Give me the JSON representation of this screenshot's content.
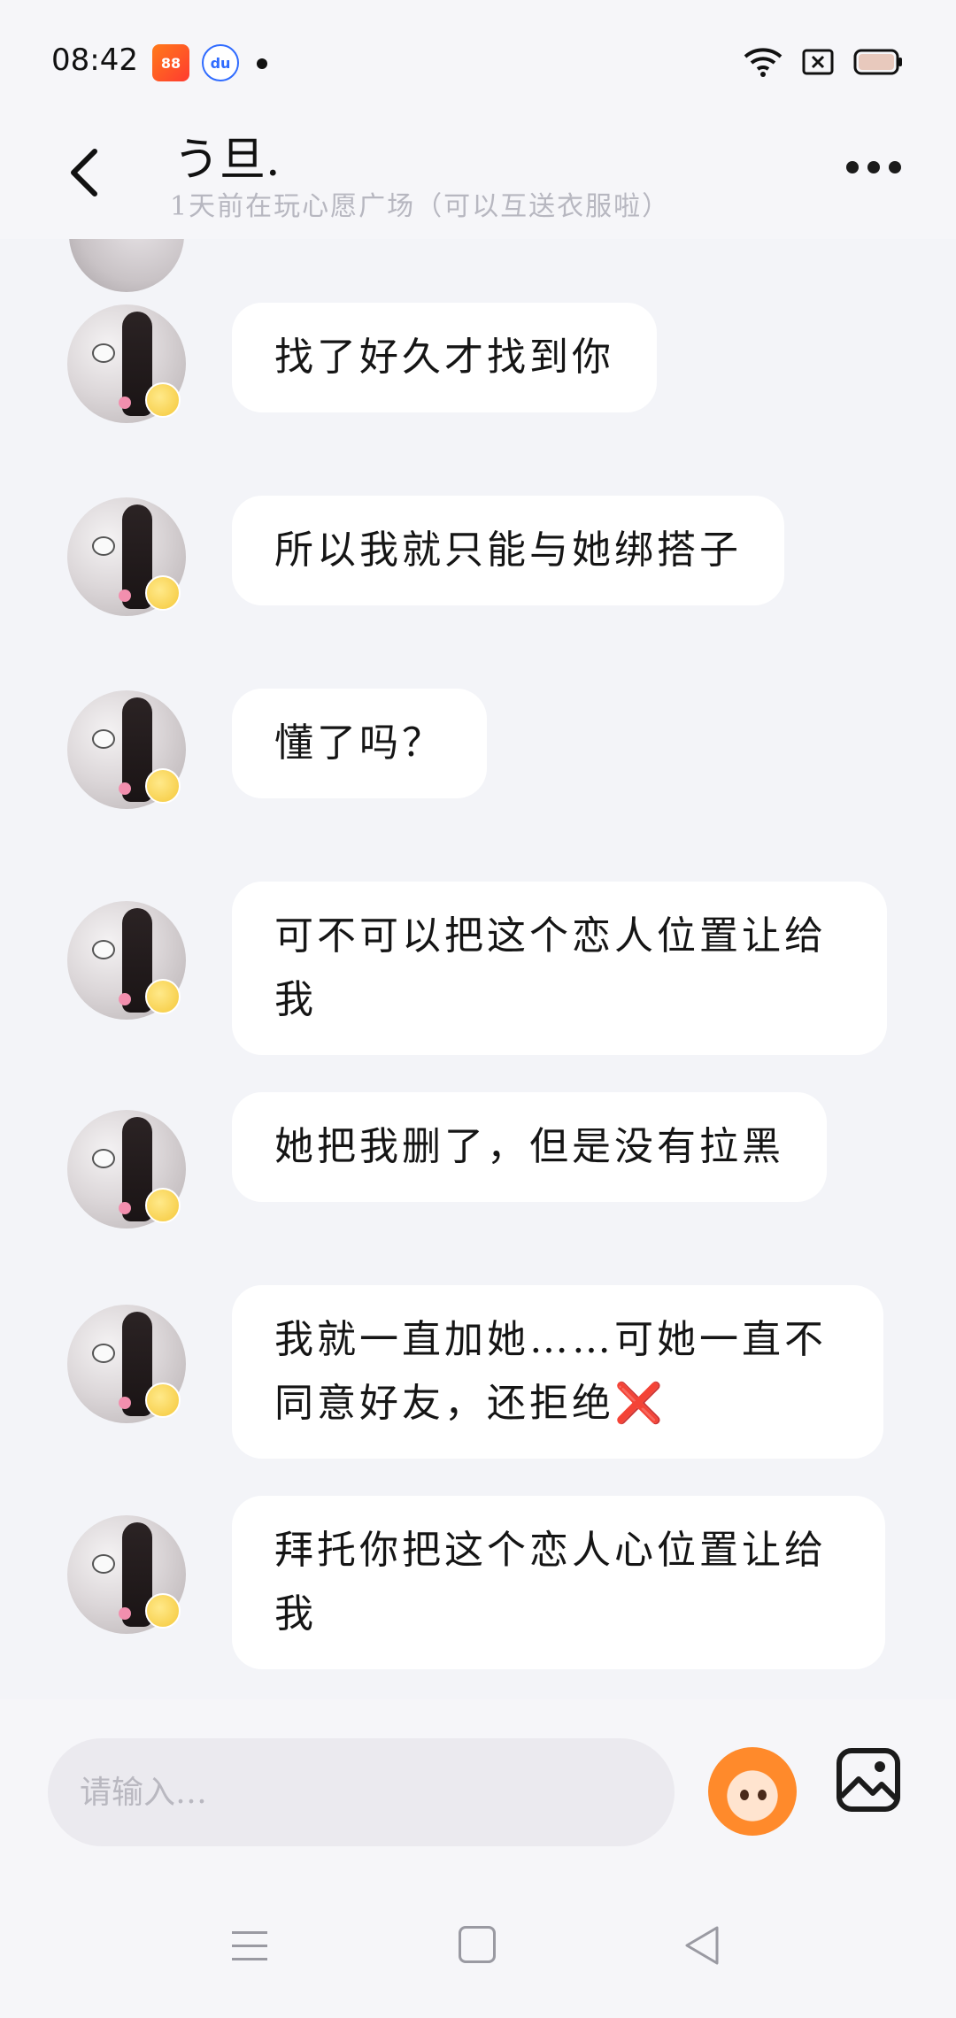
{
  "status_bar": {
    "time": "08:42",
    "apps": [
      "kuaishou-icon",
      "baidu-icon"
    ]
  },
  "header": {
    "title": "う旦.",
    "subtitle": "1天前在玩心愿广场（可以互送衣服啦）"
  },
  "messages": [
    {
      "text": "找了好久才找到你"
    },
    {
      "text": "所以我就只能与她绑搭子"
    },
    {
      "text": "懂了吗？"
    },
    {
      "text": "可不可以把这个恋人位置让给我"
    },
    {
      "text": "她把我删了，但是没有拉黑"
    },
    {
      "text": "我就一直加她……可她一直不同意好友，还拒绝❌"
    },
    {
      "text": "拜托你把这个恋人心位置让给我"
    }
  ],
  "input": {
    "placeholder": "请输入…"
  }
}
